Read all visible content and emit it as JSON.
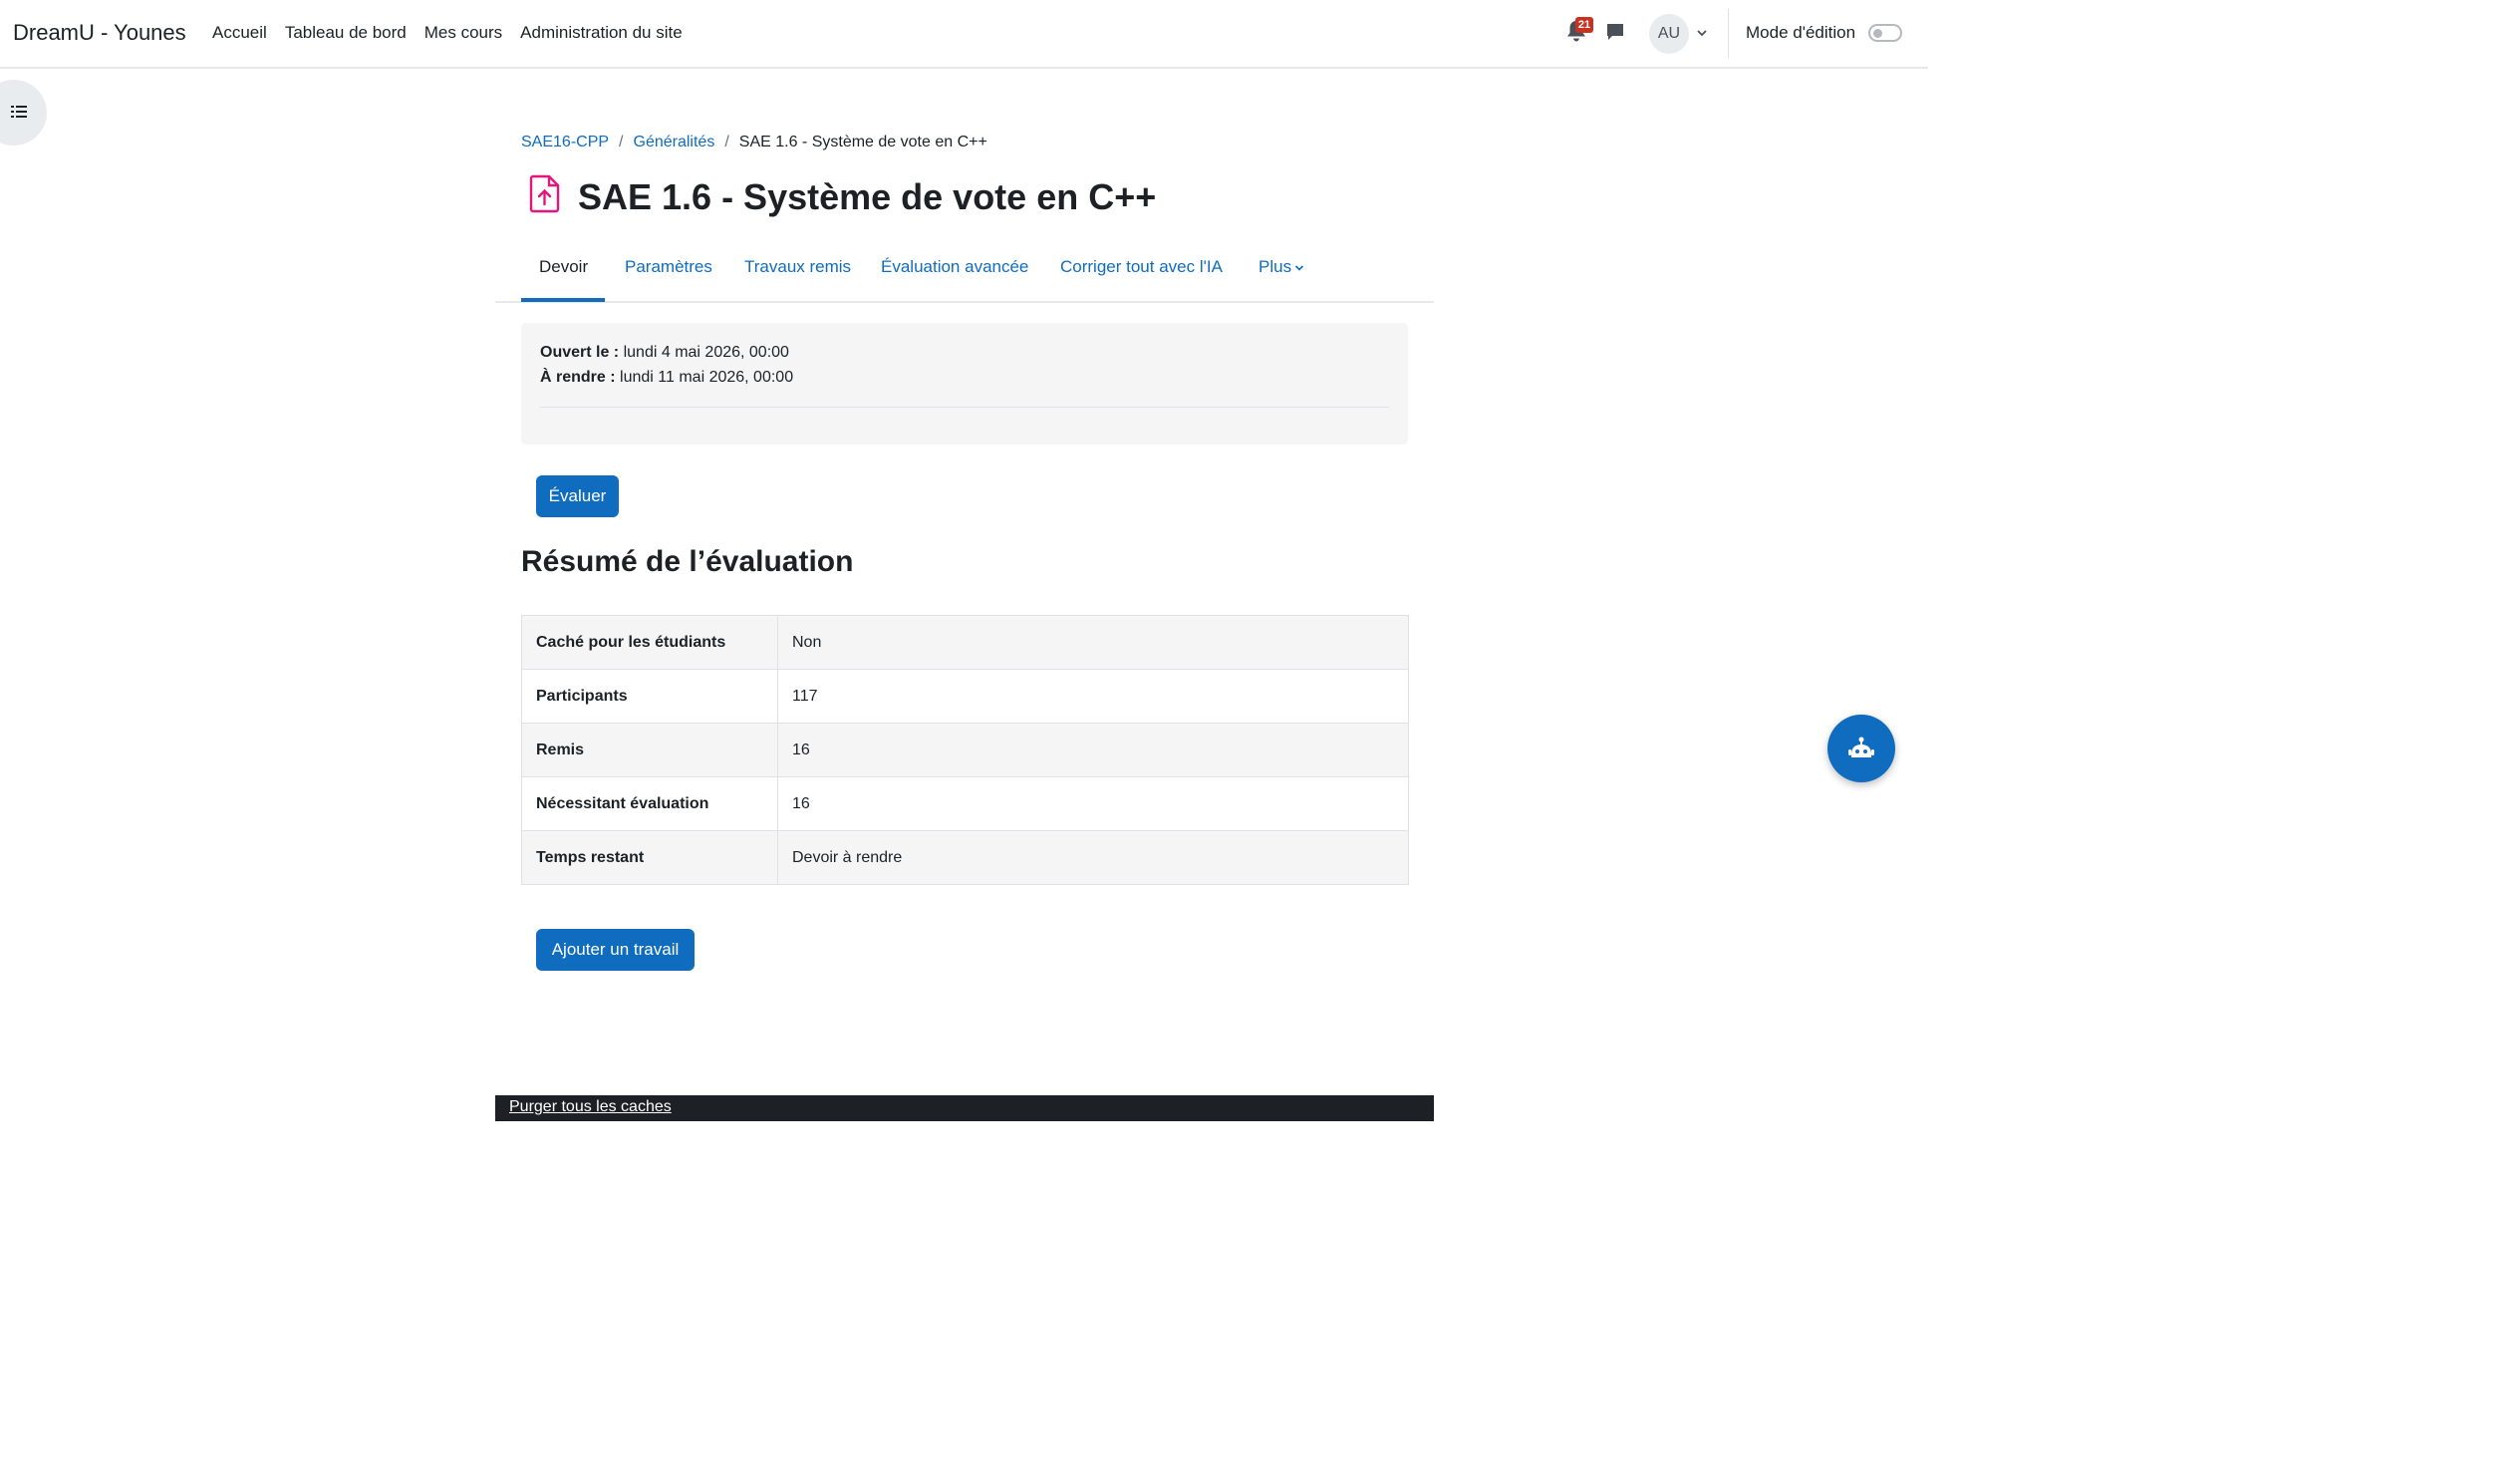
{
  "navbar": {
    "brand": "DreamU - Younes",
    "items": [
      {
        "label": "Accueil"
      },
      {
        "label": "Tableau de bord"
      },
      {
        "label": "Mes cours"
      },
      {
        "label": "Administration du site"
      }
    ],
    "notification_count": "21",
    "avatar_initials": "AU",
    "edit_mode_label": "Mode d'édition",
    "edit_mode_on": false
  },
  "breadcrumb": {
    "items": [
      {
        "label": "SAE16-CPP"
      },
      {
        "label": "Généralités"
      },
      {
        "label": "SAE 1.6 - Système de vote en C++"
      }
    ],
    "separator": "/"
  },
  "page": {
    "title": "SAE 1.6 - Système de vote en C++",
    "icon": "assignment-upload-icon",
    "icon_color": "#e5157a"
  },
  "tabs": [
    {
      "label": "Devoir",
      "active": true
    },
    {
      "label": "Paramètres"
    },
    {
      "label": "Travaux remis"
    },
    {
      "label": "Évaluation avancée"
    },
    {
      "label": "Corriger tout avec l'IA"
    },
    {
      "label": "Plus"
    }
  ],
  "dates": {
    "opened_label": "Ouvert le :",
    "opened_value": "lundi 4 mai 2026, 00:00",
    "due_label": "À rendre :",
    "due_value": "lundi 11 mai 2026, 00:00"
  },
  "grade_button": "Évaluer",
  "summary": {
    "title": "Résumé de l’évaluation",
    "rows": [
      {
        "label": "Caché pour les étudiants",
        "value": "Non"
      },
      {
        "label": "Participants",
        "value": "117"
      },
      {
        "label": "Remis",
        "value": "16"
      },
      {
        "label": "Nécessitant évaluation",
        "value": "16"
      },
      {
        "label": "Temps restant",
        "value": "Devoir à rendre"
      }
    ]
  },
  "add_submission_button": "Ajouter un travail",
  "footer": {
    "purge_link": "Purger tous les caches"
  },
  "colors": {
    "primary": "#0f6cbf",
    "badge": "#ca3120",
    "footer_bg": "#1d2125"
  }
}
